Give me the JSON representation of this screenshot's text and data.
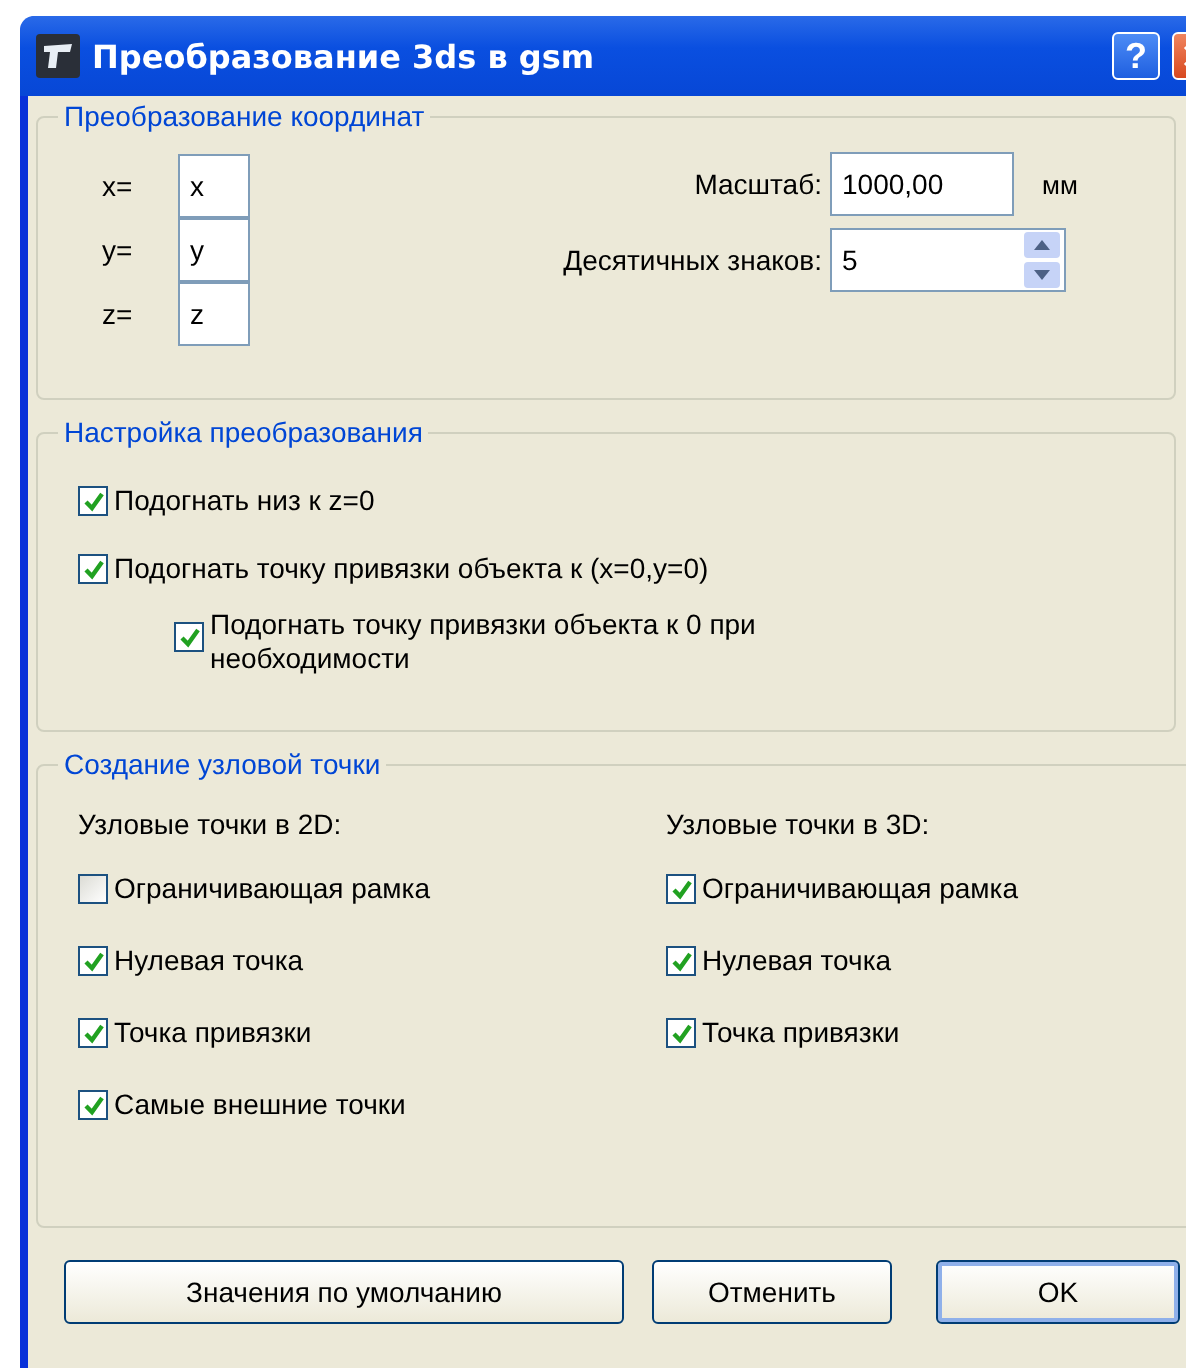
{
  "window": {
    "title": "Преобразование 3ds в gsm",
    "help_button": "?"
  },
  "coordinates": {
    "title": "Преобразование координат",
    "axes": [
      {
        "label": "x=",
        "value": "x"
      },
      {
        "label": "y=",
        "value": "y"
      },
      {
        "label": "z=",
        "value": "z"
      }
    ],
    "scale": {
      "label": "Масштаб:",
      "value": "1000,00",
      "unit": "мм"
    },
    "decimals": {
      "label": "Десятичных знаков:",
      "value": "5"
    }
  },
  "conversion": {
    "title": "Настройка преобразования",
    "options": [
      {
        "label": "Подогнать низ к z=0",
        "checked": true
      },
      {
        "label": "Подогнать точку привязки объекта к (x=0,y=0)",
        "checked": true,
        "children": [
          {
            "label": "Подогнать точку привязки объекта к 0 при необходимости",
            "checked": true
          }
        ]
      }
    ]
  },
  "nodes": {
    "title": "Создание узловой точки",
    "columns": [
      {
        "heading": "Узловые точки в 2D:",
        "options": [
          {
            "label": "Ограничивающая рамка",
            "checked": false
          },
          {
            "label": "Нулевая точка",
            "checked": true
          },
          {
            "label": "Точка привязки",
            "checked": true
          },
          {
            "label": "Самые внешние точки",
            "checked": true
          }
        ]
      },
      {
        "heading": "Узловые точки в 3D:",
        "options": [
          {
            "label": "Ограничивающая рамка",
            "checked": true
          },
          {
            "label": "Нулевая точка",
            "checked": true
          },
          {
            "label": "Точка привязки",
            "checked": true
          }
        ]
      }
    ]
  },
  "buttons": [
    {
      "label": "Значения по умолчанию",
      "default": false
    },
    {
      "label": "Отменить",
      "default": false
    },
    {
      "label": "OK",
      "default": true
    }
  ]
}
